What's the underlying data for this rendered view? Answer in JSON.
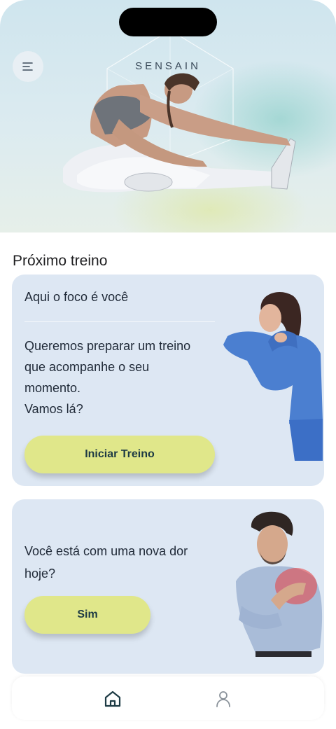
{
  "hero": {
    "brand": "SENSAIN",
    "menu_icon": "menu-icon"
  },
  "section": {
    "title": "Próximo treino"
  },
  "workout_card": {
    "heading": "Aqui o foco é você",
    "body_lines": [
      "Queremos preparar um treino",
      "que acompanhe o seu",
      "momento.",
      "Vamos lá?"
    ],
    "button_label": "Iniciar Treino"
  },
  "pain_card": {
    "question": "Você está com uma nova dor hoje?",
    "button_label": "Sim"
  },
  "tabbar": {
    "items": [
      {
        "name": "home",
        "icon": "home-icon",
        "active": true
      },
      {
        "name": "profile",
        "icon": "user-icon",
        "active": false
      }
    ]
  },
  "colors": {
    "card_bg": "#dde7f3",
    "button_bg": "#e0e78a",
    "button_text": "#1d3a44",
    "active_tab": "#1d3a44",
    "inactive_tab": "#8a929a"
  }
}
